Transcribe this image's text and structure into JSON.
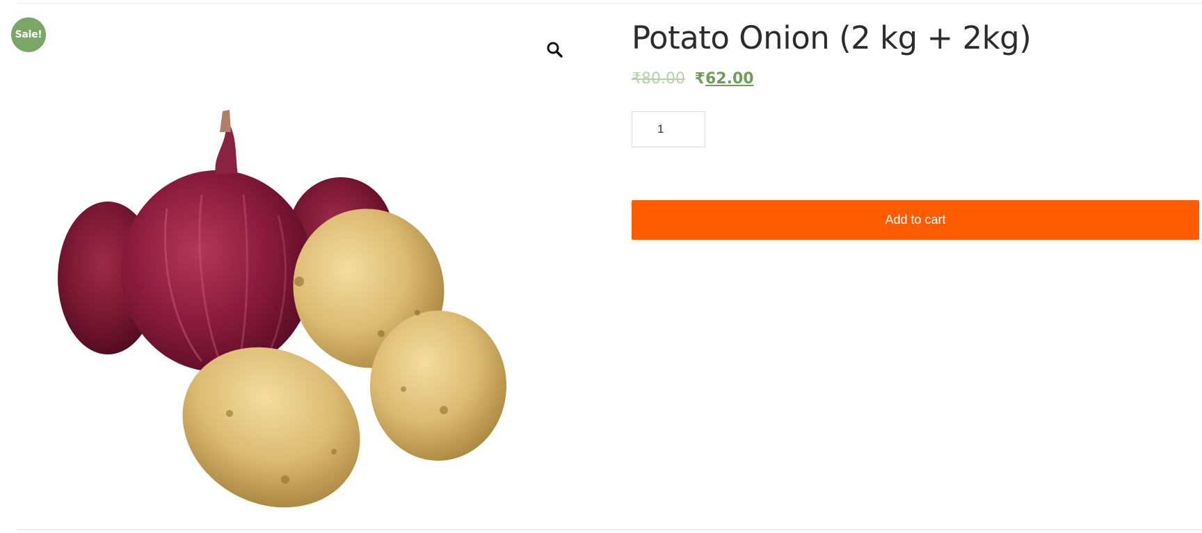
{
  "colors": {
    "sale_badge_bg": "#7aa765",
    "price_new": "#6e9e58",
    "price_old": "#b6cfa4",
    "button_bg": "#ff5c00",
    "title": "#2c2c2c"
  },
  "gallery": {
    "sale_badge": "Sale!",
    "zoom_icon": "search-icon"
  },
  "product": {
    "title": "Potato Onion (2 kg + 2kg)",
    "price_old": "₹80.00",
    "price_new_currency": "₹",
    "price_new_amount": "62.00",
    "quantity": "1",
    "add_to_cart_label": "Add to cart"
  }
}
